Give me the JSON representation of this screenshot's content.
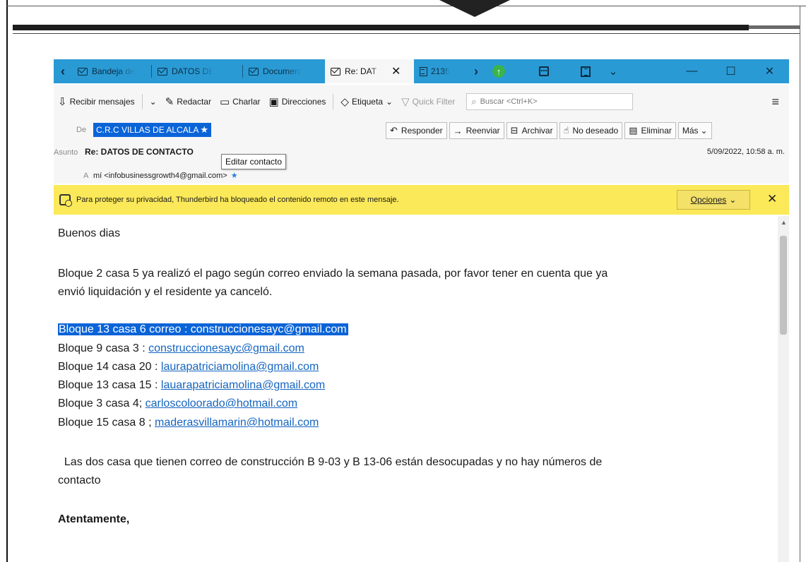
{
  "tabs": [
    {
      "label": "Bandeja de",
      "icon": "mail-icon"
    },
    {
      "label": "DATOS DE",
      "icon": "mail-icon"
    },
    {
      "label": "Document",
      "icon": "mail-icon"
    },
    {
      "label": "Re: DAT",
      "icon": "mail-icon",
      "active": true
    },
    {
      "label": "2135",
      "icon": "document-icon"
    }
  ],
  "toolbar": {
    "get_messages": "Recibir mensajes",
    "write": "Redactar",
    "chat": "Charlar",
    "address_book": "Direcciones",
    "tag": "Etiqueta",
    "quick_filter": "Quick Filter",
    "search_placeholder": "Buscar <Ctrl+K>"
  },
  "header": {
    "from_label": "De",
    "from_value": "C.R.C VILLAS DE ALCALA",
    "subject_label": "Asunto",
    "subject_value": "Re: DATOS DE CONTACTO",
    "to_label": "A",
    "to_value": "mí <infobusinessgrowth4@gmail.com>",
    "tooltip": "Editar contacto",
    "date": "5/09/2022, 10:58 a. m.",
    "buttons": {
      "reply": "Responder",
      "forward": "Reenviar",
      "archive": "Archivar",
      "junk": "No deseado",
      "delete": "Eliminar",
      "more": "Más"
    }
  },
  "notice": {
    "text": "Para proteger su privacidad, Thunderbird ha bloqueado el contenido remoto en este mensaje.",
    "options_label": "Opciones"
  },
  "message": {
    "greeting": "Buenos dias",
    "para1_line1": "Bloque 2 casa 5 ya realizó el pago según correo enviado la semana pasada, por favor tener en cuenta que ya",
    "para1_line2": "envió liquidación y el residente ya canceló.",
    "highlight_line": "Bloque 13 casa 6   correo : construccionesayc@gmail.com",
    "contacts": [
      {
        "prefix": "Bloque 9 casa 3 : ",
        "email": "construccionesayc@gmail.com"
      },
      {
        "prefix": "Bloque 14 casa 20 : ",
        "email": "laurapatriciamolina@gmail.com"
      },
      {
        "prefix": "Bloque 13 casa 15 : ",
        "email": "lauarapatriciamolina@gmail.com"
      },
      {
        "prefix": "Bloque 3 casa 4; ",
        "email": "carloscoloorado@hotmail.com"
      },
      {
        "prefix": "Bloque 15 casa 8 ; ",
        "email": "maderasvillamarin@hotmail.com"
      }
    ],
    "para2_line1": "  Las dos casa que tienen correo de construcción B 9-03 y B 13-06 están desocupadas y no hay números de",
    "para2_line2": "contacto",
    "closing": "Atentamente,"
  }
}
